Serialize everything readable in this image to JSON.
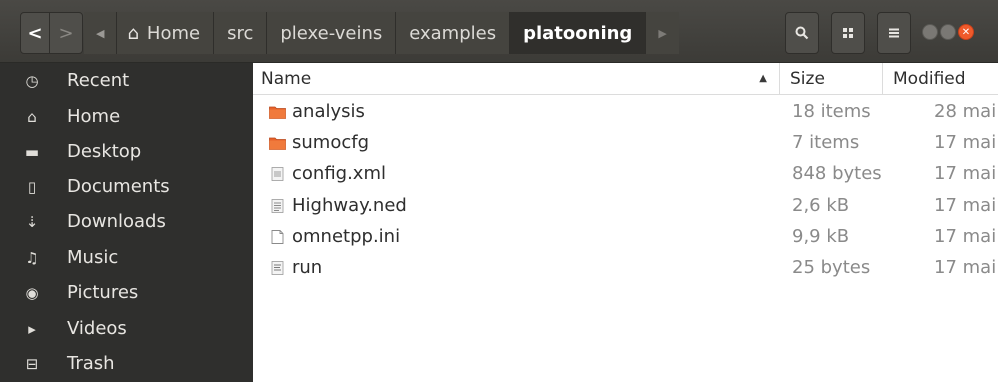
{
  "header": {
    "back_glyph": "<",
    "forward_glyph": ">",
    "breadcrumb_left_arrow": "◀",
    "breadcrumb_right_arrow": "▶",
    "home_glyph": "⌂",
    "breadcrumbs": [
      "Home",
      "src",
      "plexe-veins",
      "examples",
      "platooning"
    ],
    "active_crumb": "platooning",
    "close_glyph": "✕"
  },
  "sidebar": {
    "items": [
      {
        "label": "Recent",
        "icon": "clock-icon",
        "glyph": "◷"
      },
      {
        "label": "Home",
        "icon": "home-icon",
        "glyph": "⌂"
      },
      {
        "label": "Desktop",
        "icon": "folder-icon",
        "glyph": "▬"
      },
      {
        "label": "Documents",
        "icon": "document-icon",
        "glyph": "▯"
      },
      {
        "label": "Downloads",
        "icon": "download-icon",
        "glyph": "⇣"
      },
      {
        "label": "Music",
        "icon": "music-icon",
        "glyph": "♫"
      },
      {
        "label": "Pictures",
        "icon": "camera-icon",
        "glyph": "◉"
      },
      {
        "label": "Videos",
        "icon": "video-icon",
        "glyph": "▸"
      },
      {
        "label": "Trash",
        "icon": "trash-icon",
        "glyph": "⊟"
      }
    ]
  },
  "columns": {
    "name": "Name",
    "size": "Size",
    "modified": "Modified",
    "sort_glyph": "▲"
  },
  "files": [
    {
      "name": "analysis",
      "size": "18 items",
      "modified": "28 mai",
      "type": "folder"
    },
    {
      "name": "sumocfg",
      "size": "7 items",
      "modified": "17 mai",
      "type": "folder"
    },
    {
      "name": "config.xml",
      "size": "848 bytes",
      "modified": "17 mai",
      "type": "xml"
    },
    {
      "name": "Highway.ned",
      "size": "2,6 kB",
      "modified": "17 mai",
      "type": "text"
    },
    {
      "name": "omnetpp.ini",
      "size": "9,9 kB",
      "modified": "17 mai",
      "type": "blank"
    },
    {
      "name": "run",
      "size": "25 bytes",
      "modified": "17 mai",
      "type": "script"
    }
  ],
  "colors": {
    "folder": "#e8622a",
    "sidebar_bg": "#2f2f2d",
    "header_bg": "#3c3b37"
  }
}
